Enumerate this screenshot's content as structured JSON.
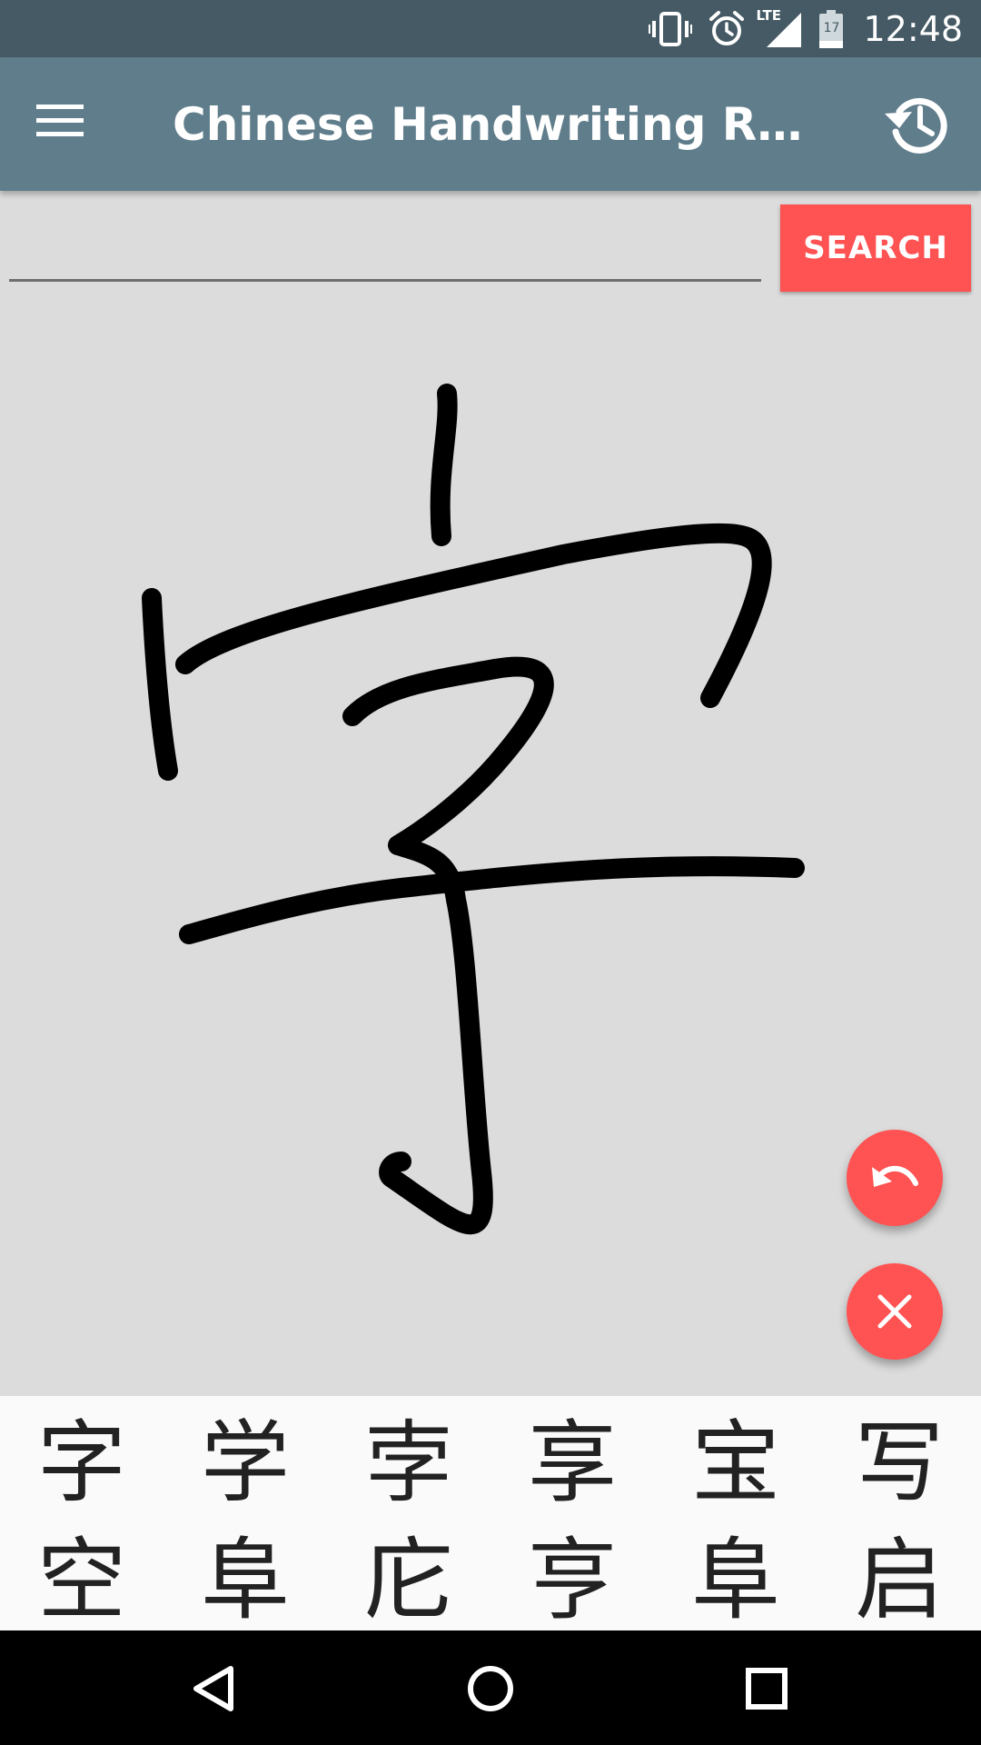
{
  "status_bar": {
    "time": "12:48",
    "network": "LTE",
    "battery": "17",
    "icons": [
      "vibrate-icon",
      "alarm-icon",
      "lte-signal-icon",
      "battery-icon"
    ]
  },
  "app_bar": {
    "title": "Chinese Handwriting Recogn…",
    "icons": [
      "menu-icon",
      "history-icon"
    ]
  },
  "search": {
    "value": "",
    "button_label": "SEARCH"
  },
  "fabs": {
    "undo_icon": "undo-icon",
    "clear_icon": "close-icon"
  },
  "candidates": {
    "row1": [
      "字",
      "学",
      "孛",
      "享",
      "宝",
      "写"
    ],
    "row2": [
      "空",
      "阜",
      "庀",
      "亨",
      "阜",
      "启"
    ]
  },
  "nav_bar": {
    "icons": [
      "back-icon",
      "home-icon",
      "recents-icon"
    ]
  },
  "colors": {
    "status_bar": "#455a64",
    "app_bar": "#607d8b",
    "accent": "#ff5252",
    "canvas": "#dcdcdc",
    "candidate_bg": "#fafafa"
  }
}
